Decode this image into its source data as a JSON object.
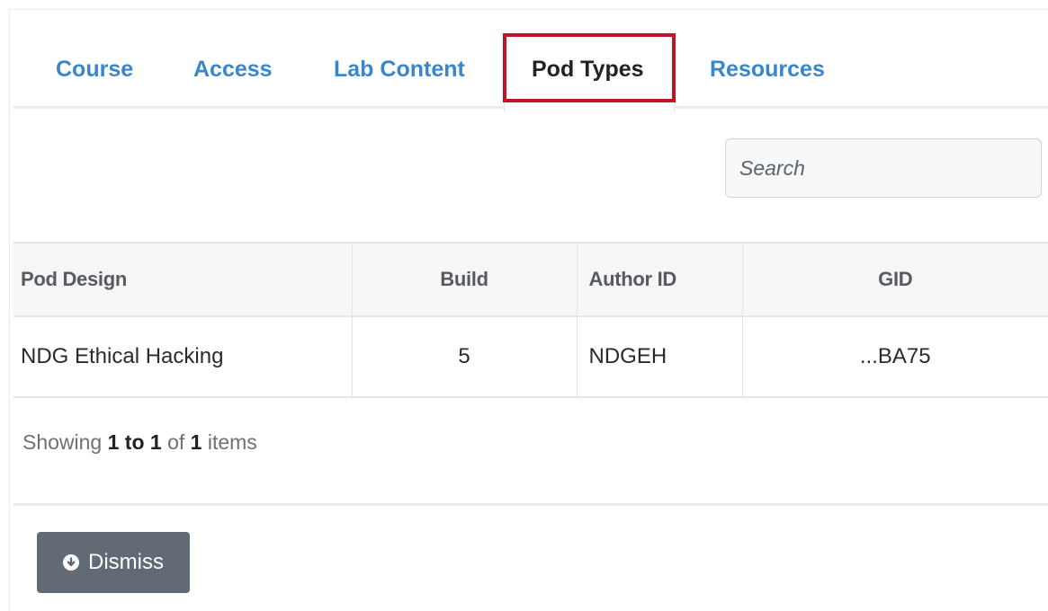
{
  "tabs": {
    "course": "Course",
    "access": "Access",
    "lab_content": "Lab Content",
    "pod_types": "Pod Types",
    "resources": "Resources"
  },
  "search": {
    "placeholder": "Search"
  },
  "table": {
    "headers": {
      "pod_design": "Pod Design",
      "build": "Build",
      "author_id": "Author ID",
      "gid": "GID"
    },
    "rows": [
      {
        "pod_design": "NDG Ethical Hacking",
        "build": "5",
        "author_id": "NDGEH",
        "gid": "...BA75"
      }
    ]
  },
  "pager": {
    "prefix": "Showing",
    "range": "1 to 1",
    "of": "of",
    "total": "1",
    "suffix": "items"
  },
  "actions": {
    "dismiss_label": "Dismiss",
    "dismiss_icon": "arrow-circle-down-icon"
  },
  "colors": {
    "tab_link": "#3a86c8",
    "highlight": "#c0142a",
    "button_bg": "#626a75"
  }
}
